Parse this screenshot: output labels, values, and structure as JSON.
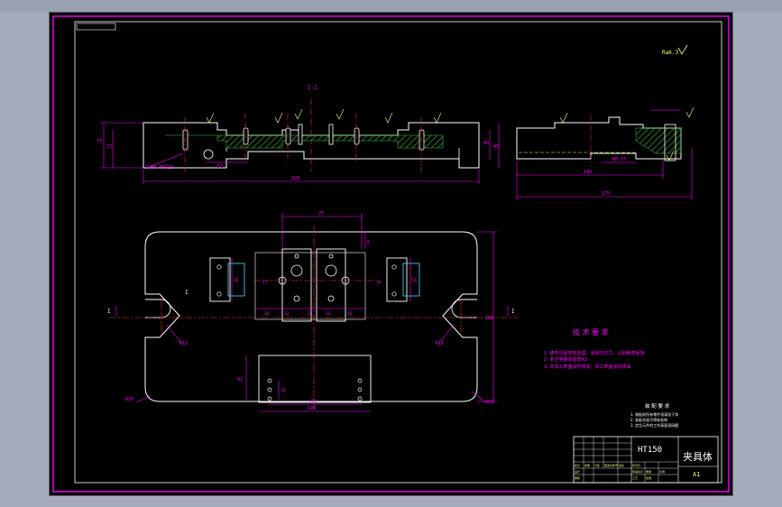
{
  "drawing": {
    "title": "夹具体",
    "material": "HT150",
    "sheet_size": "A1",
    "section_label": "I-I",
    "roughness_mark": "Ra6.3"
  },
  "tech_requirements": {
    "heading": "技 术 要 求",
    "items": [
      "1. 铸件应经时效处理，消除内应力，以利精度保持",
      "2. 未注明铸造圆角R3",
      "3. 非加工表面涂防锈漆，加工表面涂防锈油"
    ]
  },
  "assembly_requirements": {
    "heading": "装 配 要 求",
    "items": [
      "1. 装配前所有零件须清洗干净",
      "2. 各配合面不得有毛刺",
      "3. 定位元件的工作表面须研磨"
    ]
  },
  "title_block": {
    "row_labels": [
      "标记",
      "处数",
      "分区",
      "更改文件号",
      "签名",
      "年月日"
    ],
    "role_labels": [
      "设计",
      "审核",
      "工艺",
      "批准"
    ],
    "scale_labels": [
      "阶段标记",
      "重量",
      "比例"
    ]
  },
  "dimensions": {
    "front_height": "75",
    "front_height_b": "72",
    "front_right_height": "60",
    "front_right_height_b": "45",
    "front_total": "328",
    "front_inner": "52",
    "front_hole_note": "2×M8-7H深15",
    "side_total": "175",
    "side_inner": "140",
    "side_slot": "R0.57",
    "plan_top_width": "75",
    "plan_top_height": "6",
    "plan_right_height": "180",
    "plan_bottom_width": "170",
    "plan_bottom_width_b": "114",
    "plan_left_height": "92",
    "plan_radius_outer": "R20",
    "plan_radius_slot": "R11",
    "plan_radius_slot_r": "R11",
    "plan_radius_corner_r": "R15",
    "plan_mid_a": "16",
    "plan_mid_b": "32",
    "plan_mid_c": "16",
    "plan_mid_d": "32",
    "plan_mid_e": "16",
    "plan_left_block": "56",
    "plan_right_block": "56",
    "plan_hole_spacing": "18",
    "plan_hole_spacing_b": "25",
    "plan_small_h": "10",
    "section_mark_left": "I",
    "section_mark_right": "I",
    "plan_label_i": "I"
  },
  "colors": {
    "outline": "#ffffff",
    "dimension": "#ff00ff",
    "centerline": "#ff3030",
    "hatch": "#38c438",
    "hidden": "#ffff40",
    "sheet_border": "#ff00ff",
    "annotation": "#ffff80"
  }
}
